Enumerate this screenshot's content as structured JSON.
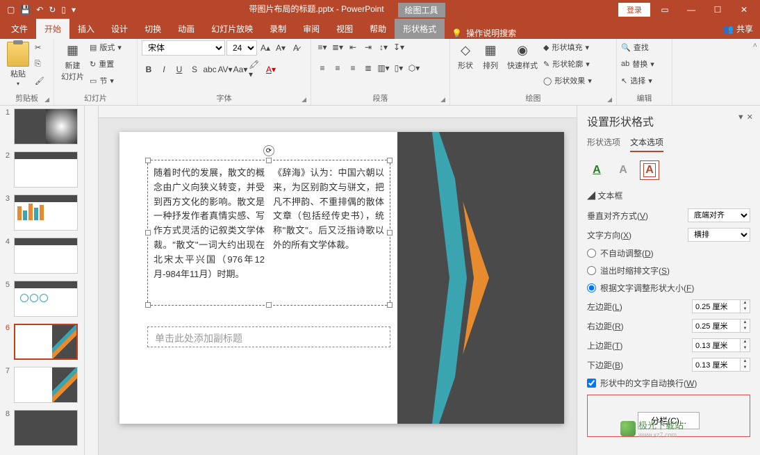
{
  "title": "带图片布局的标题.pptx - PowerPoint",
  "context_tool": "绘图工具",
  "login": "登录",
  "share": "共享",
  "tabs": {
    "file": "文件",
    "home": "开始",
    "insert": "插入",
    "design": "设计",
    "transitions": "切换",
    "animations": "动画",
    "slideshow": "幻灯片放映",
    "record": "录制",
    "review": "审阅",
    "view": "视图",
    "help": "帮助",
    "shapeformat": "形状格式"
  },
  "tellme": "操作说明搜索",
  "ribbon": {
    "clipboard": {
      "label": "剪贴板",
      "paste": "粘贴"
    },
    "slides": {
      "label": "幻灯片",
      "new": "新建\n幻灯片",
      "layout": "版式",
      "reset": "重置",
      "section": "节"
    },
    "font": {
      "label": "字体",
      "name": "宋体",
      "size": "24"
    },
    "paragraph": {
      "label": "段落"
    },
    "drawing": {
      "label": "绘图",
      "shapes": "形状",
      "arrange": "排列",
      "quickstyles": "快速样式",
      "fill": "形状填充",
      "outline": "形状轮廓",
      "effects": "形状效果"
    },
    "editing": {
      "label": "编辑",
      "find": "查找",
      "replace": "替换",
      "select": "选择"
    }
  },
  "slide": {
    "text_col1": "随着时代的发展，散文的概念由广义向狭义转变，并受到西方文化的影响。散文是一种抒发作者真情实感、写作方式灵活的记叙类文学体裁。\"散文\"一词大约出现在北宋太平兴国（976年12月-984年11月）时期。",
    "text_col2": "《辞海》认为：中国六朝以来，为区别韵文与骈文，把凡不押韵、不重排偶的散体文章（包括经传史书），统称\"散文\"。后又泛指诗歌以外的所有文学体裁。",
    "subtitle_placeholder": "单击此处添加副标题"
  },
  "thumbs": [
    "1",
    "2",
    "3",
    "4",
    "5",
    "6",
    "7",
    "8"
  ],
  "pane": {
    "title": "设置形状格式",
    "tab_shape": "形状选项",
    "tab_text": "文本选项",
    "section": "文本框",
    "valign_label": "垂直对齐方式(V)",
    "valign_value": "底端对齐",
    "textdir_label": "文字方向(X)",
    "textdir_value": "横排",
    "autofit_none": "不自动调整(D)",
    "autofit_shrink": "溢出时缩排文字(S)",
    "autofit_resize": "根据文字调整形状大小(F)",
    "margin_left": "左边距(L)",
    "margin_right": "右边距(R)",
    "margin_top": "上边距(T)",
    "margin_bottom": "下边距(B)",
    "ml_val": "0.25 厘米",
    "mr_val": "0.25 厘米",
    "mt_val": "0.13 厘米",
    "mb_val": "0.13 厘米",
    "wrap": "形状中的文字自动换行(W)",
    "columns": "分栏(C)..."
  },
  "watermark": {
    "name": "极光下载站",
    "url": "www.xz7.com"
  }
}
